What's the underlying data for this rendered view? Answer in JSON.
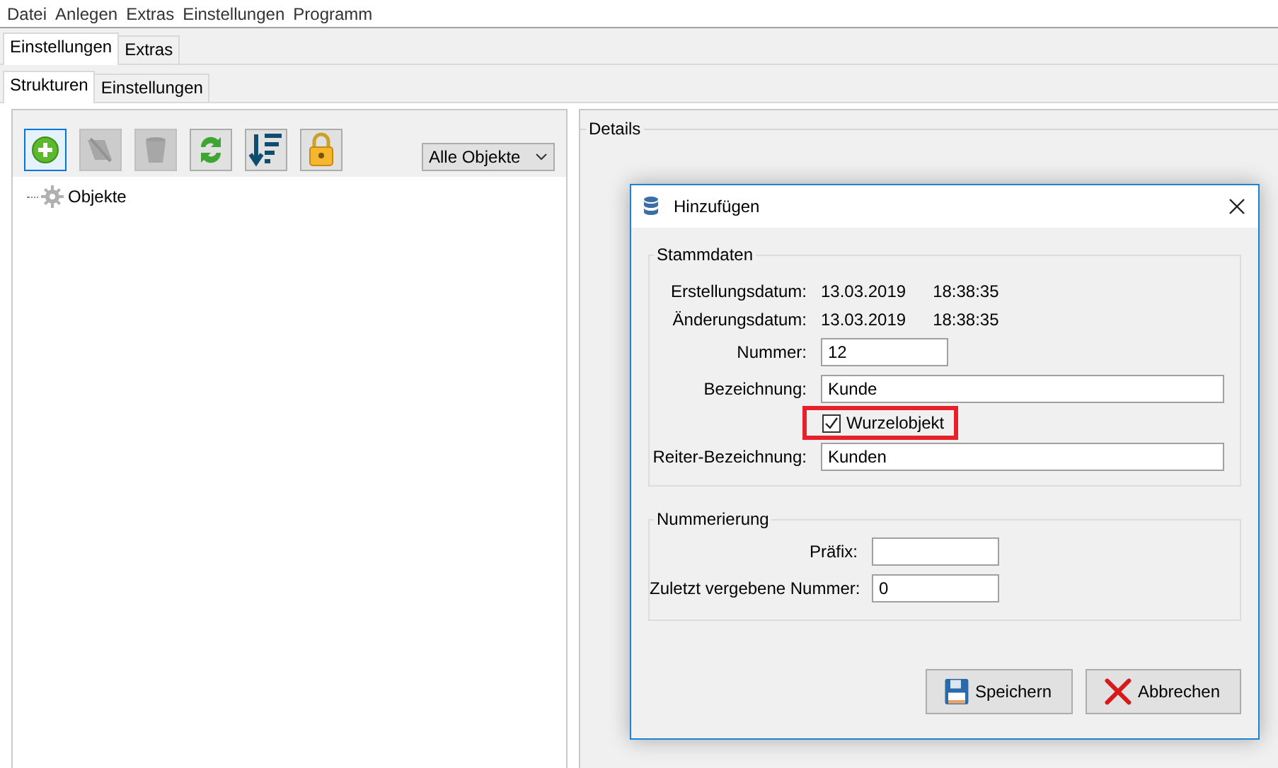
{
  "menu": [
    {
      "label": "Datei"
    },
    {
      "label": "Anlegen"
    },
    {
      "label": "Extras"
    },
    {
      "label": "Einstellungen"
    },
    {
      "label": "Programm"
    }
  ],
  "main_tabs": [
    {
      "label": "Einstellungen",
      "selected": true
    },
    {
      "label": "Extras",
      "selected": false
    }
  ],
  "sub_tabs": [
    {
      "label": "Strukturen",
      "selected": true
    },
    {
      "label": "Einstellungen",
      "selected": false
    }
  ],
  "toolbar": {
    "buttons": [
      {
        "kind": "add",
        "disabled": false,
        "focused": true
      },
      {
        "kind": "edit",
        "disabled": true,
        "focused": false
      },
      {
        "kind": "delete",
        "disabled": true,
        "focused": false
      },
      {
        "kind": "refresh",
        "disabled": false,
        "focused": false
      },
      {
        "kind": "sort",
        "disabled": false,
        "focused": false
      },
      {
        "kind": "lock",
        "disabled": false,
        "focused": false
      }
    ],
    "filter": {
      "value": "Alle Objekte"
    }
  },
  "tree": {
    "items": [
      {
        "label": "Objekte"
      }
    ]
  },
  "details": {
    "title": "Details"
  },
  "dialog": {
    "title": "Hinzufügen",
    "stammdaten": {
      "title": "Stammdaten",
      "rows": [
        {
          "kind": "info",
          "label": "Erstellungsdatum:",
          "date": "13.03.2019",
          "time": "18:38:35"
        },
        {
          "kind": "info",
          "label": "Änderungsdatum:",
          "date": "13.03.2019",
          "time": "18:38:35"
        },
        {
          "kind": "number",
          "label": "Nummer:",
          "value": "12"
        },
        {
          "kind": "text",
          "label": "Bezeichnung:",
          "value": "Kunde"
        },
        {
          "kind": "checkbox",
          "label": "Wurzelobjekt",
          "checked": true,
          "highlighted": true
        },
        {
          "kind": "text",
          "label": "Reiter-Bezeichnung:",
          "value": "Kunden"
        }
      ]
    },
    "nummerierung": {
      "title": "Nummerierung",
      "rows": [
        {
          "label": "Präfix:"
        },
        {
          "label": "Zuletzt vergebene Nummer:",
          "value": "0"
        }
      ]
    },
    "buttons": [
      {
        "kind": "save",
        "label": "Speichern"
      },
      {
        "kind": "cancel",
        "label": "Abbrechen"
      }
    ]
  }
}
